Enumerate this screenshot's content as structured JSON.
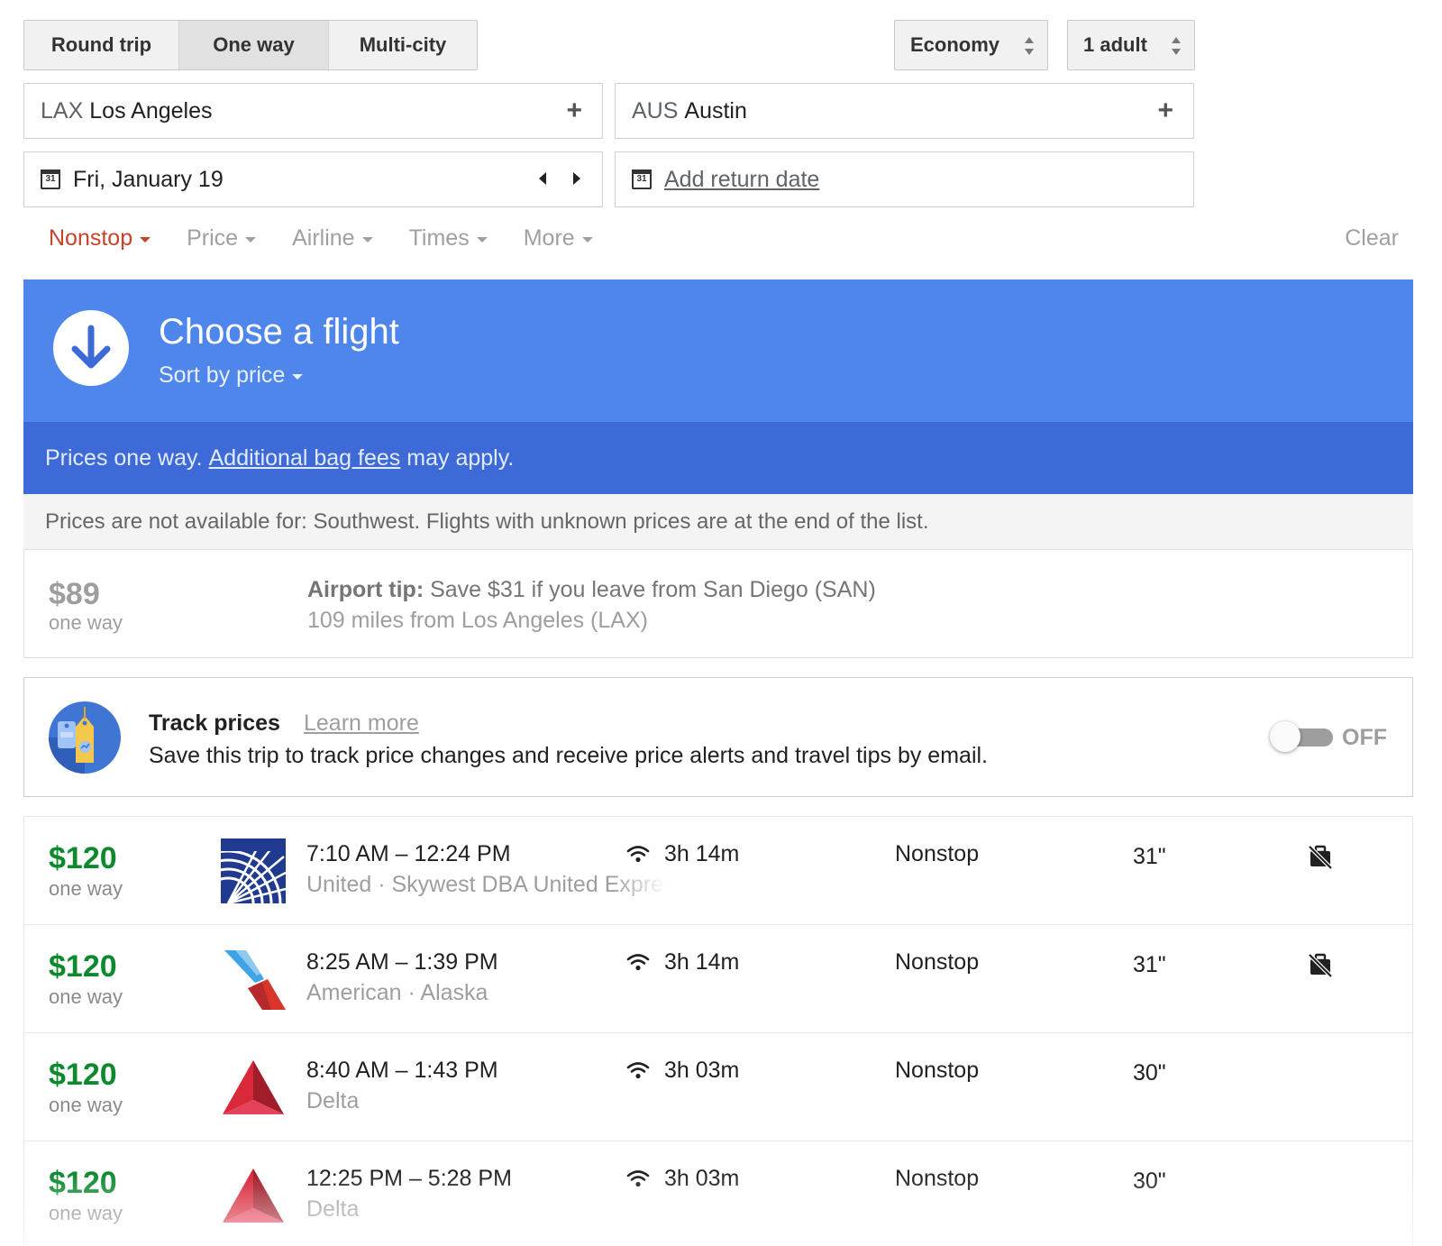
{
  "trip_type": {
    "options": [
      "Round trip",
      "One way",
      "Multi-city"
    ],
    "selected": "One way"
  },
  "cabin_class": "Economy",
  "passengers": "1 adult",
  "origin": {
    "code": "LAX",
    "city": "Los Angeles"
  },
  "destination": {
    "code": "AUS",
    "city": "Austin"
  },
  "departure_date": "Fri, January 19",
  "return_date_placeholder": "Add return date",
  "calendar_icon_text": "31",
  "filters": {
    "items": [
      {
        "label": "Nonstop",
        "active": true
      },
      {
        "label": "Price",
        "active": false
      },
      {
        "label": "Airline",
        "active": false
      },
      {
        "label": "Times",
        "active": false
      },
      {
        "label": "More",
        "active": false
      }
    ],
    "clear_label": "Clear"
  },
  "banner": {
    "title": "Choose a flight",
    "sort_label": "Sort by price"
  },
  "notice": {
    "before": "Prices one way.",
    "link": "Additional bag fees",
    "after": "may apply."
  },
  "unavailable_text": "Prices are not available for: Southwest. Flights with unknown prices are at the end of the list.",
  "airport_tip": {
    "price": "$89",
    "price_sub": "one way",
    "label": "Airport tip:",
    "text": "Save $31 if you leave from San Diego (SAN)",
    "distance": "109 miles from Los Angeles (LAX)"
  },
  "track_prices": {
    "title": "Track prices",
    "learn_more": "Learn more",
    "description": "Save this trip to track price changes and receive price alerts and travel tips by email.",
    "toggle_state": "OFF"
  },
  "flights": [
    {
      "price": "$120",
      "price_sub": "one way",
      "logo": "united-logo",
      "times": "7:10 AM – 12:24 PM",
      "airline": "United · Skywest DBA United Express",
      "duration": "3h 14m",
      "stops": "Nonstop",
      "legroom": "31\"",
      "no_carry_on": true
    },
    {
      "price": "$120",
      "price_sub": "one way",
      "logo": "american-logo",
      "times": "8:25 AM – 1:39 PM",
      "airline": "American · Alaska",
      "duration": "3h 14m",
      "stops": "Nonstop",
      "legroom": "31\"",
      "no_carry_on": true
    },
    {
      "price": "$120",
      "price_sub": "one way",
      "logo": "delta-logo",
      "times": "8:40 AM – 1:43 PM",
      "airline": "Delta",
      "duration": "3h 03m",
      "stops": "Nonstop",
      "legroom": "30\"",
      "no_carry_on": false
    },
    {
      "price": "$120",
      "price_sub": "one way",
      "logo": "delta-logo",
      "times": "12:25 PM – 5:28 PM",
      "airline": "Delta",
      "duration": "3h 03m",
      "stops": "Nonstop",
      "legroom": "30\"",
      "no_carry_on": false
    }
  ],
  "colors": {
    "banner_blue": "#4f86ec",
    "notice_blue": "#3d6ad6",
    "price_green": "#0d8a2e",
    "filter_active_red": "#c5432b"
  }
}
